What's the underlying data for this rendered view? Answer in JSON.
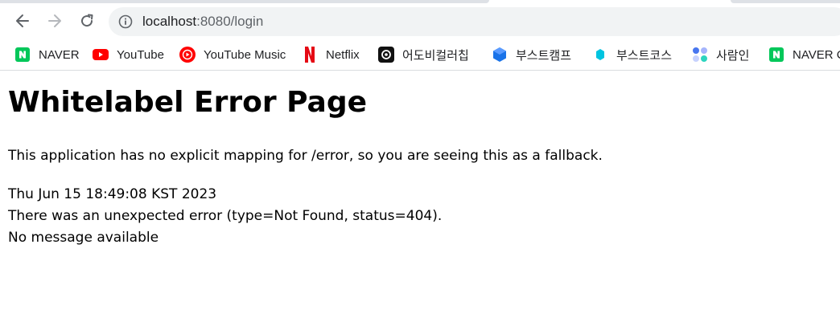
{
  "browser": {
    "url_host": "localhost",
    "url_rest": ":8080/login",
    "icons": {
      "back": "arrow-left-icon",
      "forward": "arrow-right-icon",
      "reload": "reload-icon",
      "site_info": "info-icon"
    }
  },
  "bookmarks": [
    {
      "label": "NAVER",
      "icon": "naver-icon",
      "color": "#03c75a"
    },
    {
      "label": "YouTube",
      "icon": "youtube-icon",
      "color": "#ff0000"
    },
    {
      "label": "YouTube Music",
      "icon": "youtube-music-icon",
      "color": "#ff0000"
    },
    {
      "label": "Netflix",
      "icon": "netflix-icon",
      "color": "#e50914"
    },
    {
      "label": "어도비컬러칩",
      "icon": "adobe-color-icon",
      "color": "#111111"
    },
    {
      "label": "부스트캠프",
      "icon": "boostcamp-icon",
      "color": "#1a73e8"
    },
    {
      "label": "부스트코스",
      "icon": "boostcourse-icon",
      "color": "#00c4e0"
    },
    {
      "label": "사람인",
      "icon": "saramin-icon",
      "color": "#4876ef"
    },
    {
      "label": "NAVER C",
      "icon": "naver-icon",
      "color": "#03c75a"
    }
  ],
  "page": {
    "title": "Whitelabel Error Page",
    "message": "This application has no explicit mapping for /error, so you are seeing this as a fallback.",
    "timestamp": "Thu Jun 15 18:49:08 KST 2023",
    "error_detail": "There was an unexpected error (type=Not Found, status=404).",
    "no_message": "No message available"
  }
}
